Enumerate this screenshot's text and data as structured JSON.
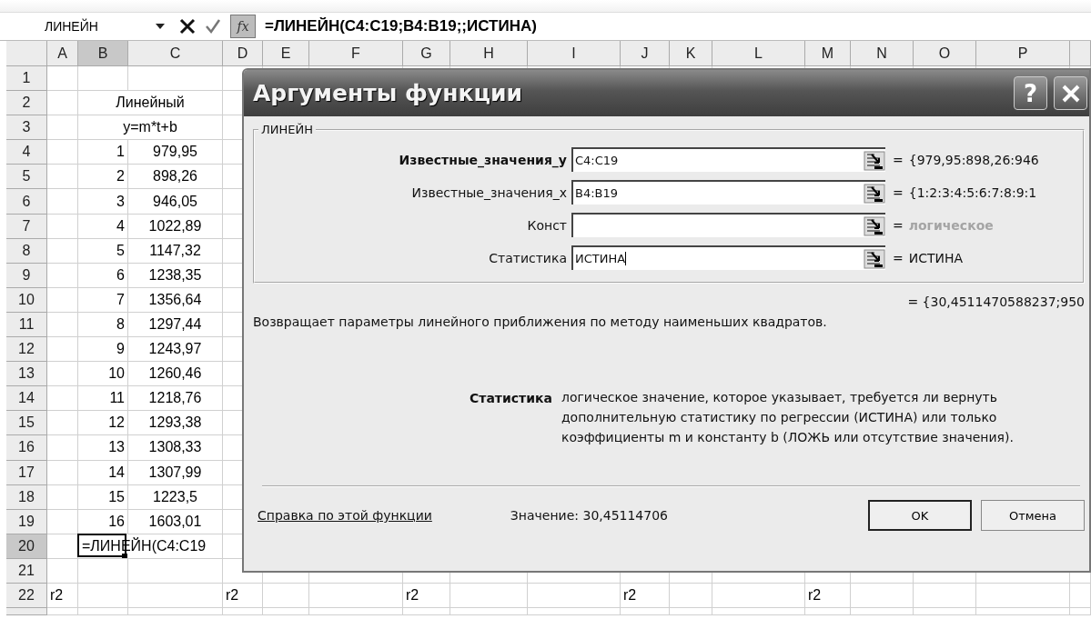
{
  "formula_bar": {
    "name_box": "ЛИНЕЙН",
    "function_button": "fx",
    "formula": "=ЛИНЕЙН(C4:C19;B4:B19;;ИСТИНА)"
  },
  "sheet": {
    "columns": [
      {
        "label": "A",
        "selected": false
      },
      {
        "label": "B",
        "selected": true
      },
      {
        "label": "C",
        "selected": false
      },
      {
        "label": "D",
        "selected": false
      },
      {
        "label": "E",
        "selected": false
      },
      {
        "label": "F",
        "selected": false
      },
      {
        "label": "G",
        "selected": false
      },
      {
        "label": "H",
        "selected": false
      },
      {
        "label": "I",
        "selected": false
      },
      {
        "label": "J",
        "selected": false
      },
      {
        "label": "K",
        "selected": false
      },
      {
        "label": "L",
        "selected": false
      },
      {
        "label": "M",
        "selected": false
      },
      {
        "label": "N",
        "selected": false
      },
      {
        "label": "O",
        "selected": false
      },
      {
        "label": "P",
        "selected": false
      }
    ],
    "rows": [
      {
        "label": "1",
        "selected": false,
        "cells": []
      },
      {
        "label": "2",
        "selected": false,
        "merged": true,
        "cells": [
          "",
          "Линейный"
        ]
      },
      {
        "label": "3",
        "selected": false,
        "merged": true,
        "cells": [
          "",
          "y=m*t+b"
        ]
      },
      {
        "label": "4",
        "selected": false,
        "cells": [
          "",
          "1",
          "979,95"
        ]
      },
      {
        "label": "5",
        "selected": false,
        "cells": [
          "",
          "2",
          "898,26"
        ]
      },
      {
        "label": "6",
        "selected": false,
        "cells": [
          "",
          "3",
          "946,05"
        ]
      },
      {
        "label": "7",
        "selected": false,
        "cells": [
          "",
          "4",
          "1022,89"
        ]
      },
      {
        "label": "8",
        "selected": false,
        "cells": [
          "",
          "5",
          "1147,32"
        ]
      },
      {
        "label": "9",
        "selected": false,
        "cells": [
          "",
          "6",
          "1238,35"
        ]
      },
      {
        "label": "10",
        "selected": false,
        "cells": [
          "",
          "7",
          "1356,64"
        ]
      },
      {
        "label": "11",
        "selected": false,
        "cells": [
          "",
          "8",
          "1297,44"
        ]
      },
      {
        "label": "12",
        "selected": false,
        "cells": [
          "",
          "9",
          "1243,97"
        ]
      },
      {
        "label": "13",
        "selected": false,
        "cells": [
          "",
          "10",
          "1260,46"
        ]
      },
      {
        "label": "14",
        "selected": false,
        "cells": [
          "",
          "11",
          "1218,76"
        ]
      },
      {
        "label": "15",
        "selected": false,
        "cells": [
          "",
          "12",
          "1293,38"
        ]
      },
      {
        "label": "16",
        "selected": false,
        "cells": [
          "",
          "13",
          "1308,33"
        ]
      },
      {
        "label": "17",
        "selected": false,
        "cells": [
          "",
          "14",
          "1307,99"
        ]
      },
      {
        "label": "18",
        "selected": false,
        "cells": [
          "",
          "15",
          "1223,5"
        ]
      },
      {
        "label": "19",
        "selected": false,
        "cells": [
          "",
          "16",
          "1603,01"
        ]
      },
      {
        "label": "20",
        "selected": true,
        "editing": true,
        "cells": [
          "",
          "=ЛИНЕЙН(C4:C19"
        ]
      },
      {
        "label": "21",
        "selected": false,
        "cells": []
      },
      {
        "label": "22",
        "selected": false,
        "cells": [
          "r2",
          "",
          "",
          "r2",
          "",
          "",
          "r2",
          "",
          "",
          "r2",
          "",
          "",
          "r2"
        ]
      }
    ]
  },
  "dialog": {
    "title": "Аргументы функции",
    "help_button": "?",
    "group_label": "ЛИНЕЙН",
    "arguments": [
      {
        "label": "Известные_значения_y",
        "required": true,
        "value": "C4:C19",
        "sign": "=",
        "result": "{979,95:898,26:946",
        "result_muted": false
      },
      {
        "label": "Известные_значения_x",
        "required": false,
        "value": "B4:B19",
        "sign": "=",
        "result": "{1:2:3:4:5:6:7:8:9:1",
        "result_muted": false
      },
      {
        "label": "Конст",
        "required": false,
        "sign": "=",
        "result": "логическое",
        "result_muted": true
      },
      {
        "label": "Статистика",
        "required": false,
        "value": "ИСТИНА",
        "sign": "=",
        "result": "ИСТИНА",
        "result_muted": false
      }
    ],
    "formula_result": "= {30,4511470588237;950",
    "description": "Возвращает параметры линейного приближения по методу наименьших квадратов.",
    "argument_help": {
      "name": "Статистика",
      "text": "логическое значение, которое указывает, требуется ли вернуть дополнительную статистику по регрессии (ИСТИНА) или только коэффициенты m и константу b (ЛОЖЬ или отсутствие значения)."
    },
    "help_link": "Справка по этой функции",
    "value": "Значение: 30,45114706",
    "buttons": [
      {
        "label": "OK",
        "default": true
      },
      {
        "label": "Отмена",
        "default": false
      }
    ]
  }
}
